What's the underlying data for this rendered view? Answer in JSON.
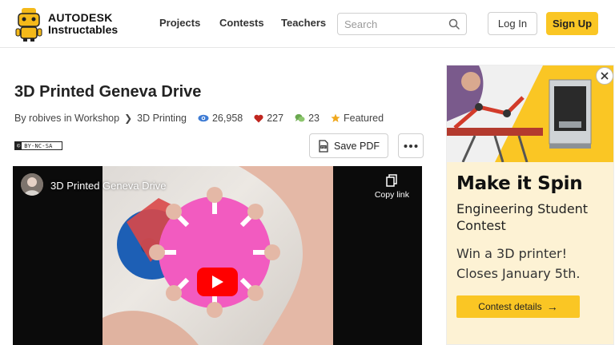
{
  "header": {
    "logo_line1": "AUTODESK",
    "logo_line2": "Instructables",
    "nav": [
      "Projects",
      "Contests",
      "Teachers"
    ],
    "search_placeholder": "Search",
    "login_label": "Log In",
    "signup_label": "Sign Up"
  },
  "article": {
    "title": "3D Printed Geneva Drive",
    "author_prefix": "By robives in Workshop",
    "category": "3D Printing",
    "views": "26,958",
    "favorites": "227",
    "comments": "23",
    "featured": "Featured",
    "license_badge": "BY-NC-SA",
    "save_pdf_label": "Save PDF"
  },
  "video": {
    "title": "3D Printed Geneva Drive",
    "copy_link_label": "Copy link"
  },
  "ad": {
    "headline": "Make it Spin",
    "subheadline": "Engineering Student Contest",
    "body": "Win a 3D printer! Closes January 5th.",
    "cta_label": "Contest details",
    "cta_arrow": "→"
  },
  "colors": {
    "accent_yellow": "#fac624",
    "ad_panel_bg": "#fdf2d4",
    "video_bg": "#0b0b0b",
    "views_icon": "#3f7cd4",
    "favorites_icon": "#c0261f",
    "comments_icon": "#6aa84f",
    "featured_icon": "#f0a81d"
  },
  "icons": {
    "search": "search-icon",
    "views": "eye-icon",
    "favorites": "heart-icon",
    "comments": "chat-bubble-icon",
    "featured": "star-icon",
    "pdf": "pdf-icon",
    "more": "more-dots-icon",
    "copy": "copy-icon",
    "play": "play-icon",
    "close": "close-icon"
  }
}
